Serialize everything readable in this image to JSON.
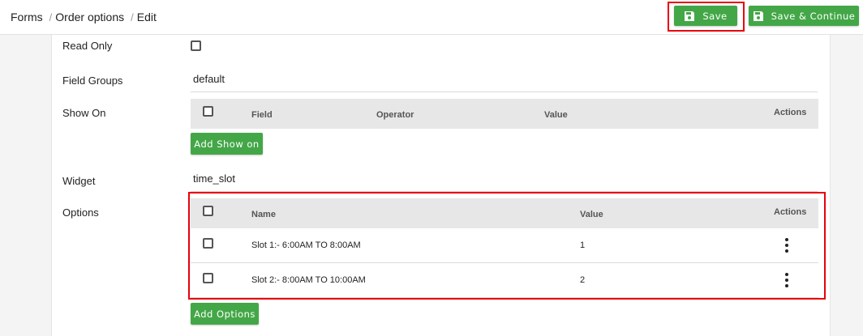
{
  "breadcrumb": {
    "items": [
      "Forms",
      "Order options",
      "Edit"
    ],
    "separator": "/"
  },
  "toolbar": {
    "save_label": "Save",
    "save_continue_label": "Save & Continue",
    "button_color": "#43a747"
  },
  "form": {
    "read_only": {
      "label": "Read Only",
      "checked": false
    },
    "field_groups": {
      "label": "Field Groups",
      "value": "default"
    },
    "show_on": {
      "label": "Show On",
      "columns": {
        "field": "Field",
        "operator": "Operator",
        "value": "Value",
        "actions": "Actions"
      },
      "add_label": "Add Show on"
    },
    "widget": {
      "label": "Widget",
      "value": "time_slot"
    },
    "options": {
      "label": "Options",
      "columns": {
        "name": "Name",
        "value": "Value",
        "actions": "Actions"
      },
      "rows": [
        {
          "name": "Slot 1:- 6:00AM TO 8:00AM",
          "value": "1"
        },
        {
          "name": "Slot 2:- 8:00AM TO 10:00AM",
          "value": "2"
        }
      ],
      "add_label": "Add Options"
    }
  },
  "highlight_color": "#e8000b"
}
